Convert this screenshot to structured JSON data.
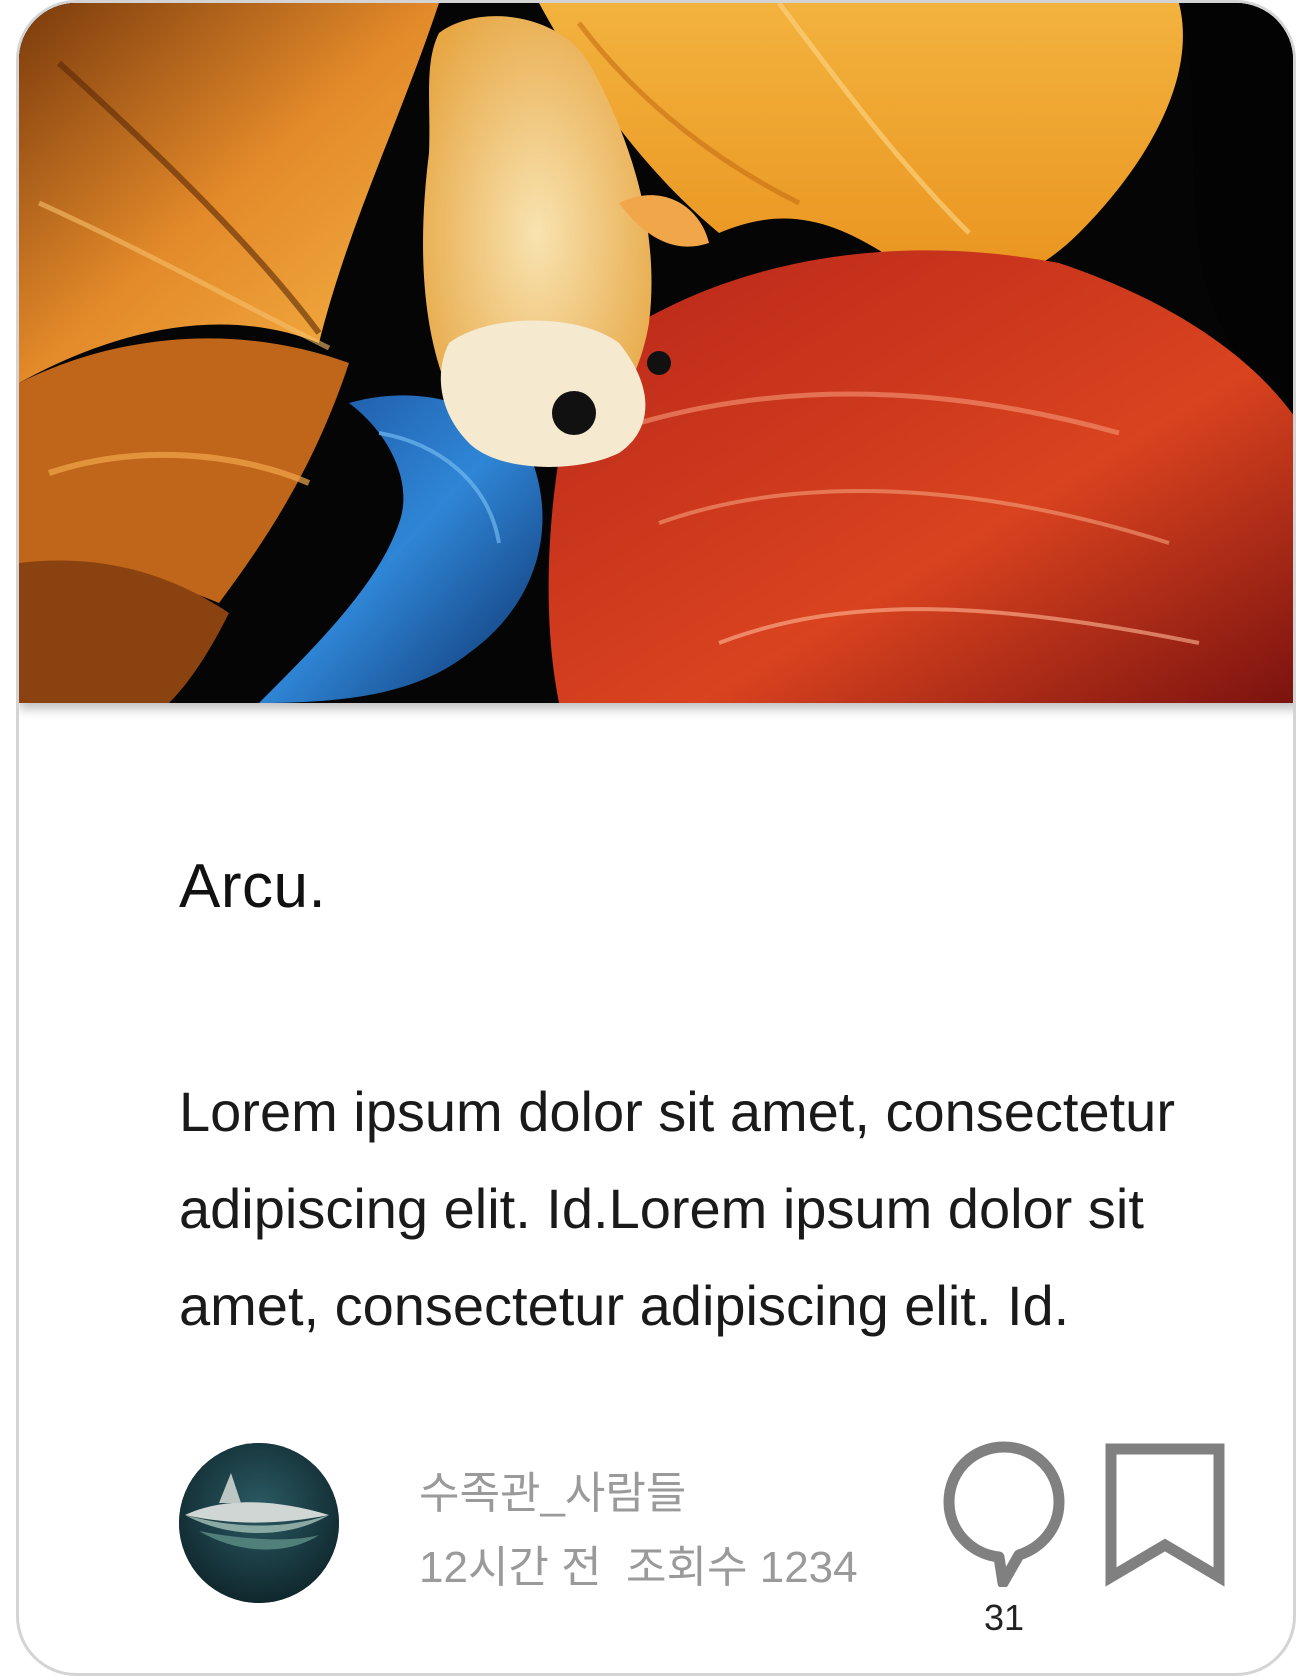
{
  "post": {
    "title": "Arcu.",
    "body": "Lorem ipsum dolor sit amet, consectetur adipiscing elit. Id.Lorem ipsum dolor sit amet, consectetur adipiscing elit. Id."
  },
  "author": {
    "name": "수족관_사람들",
    "meta": "12시간 전  조회수 1234"
  },
  "actions": {
    "comment_count": "31"
  },
  "icons": {
    "comment": "speech-bubble-icon",
    "bookmark": "bookmark-icon"
  },
  "colors": {
    "icon_gray": "#808080",
    "meta_gray": "#9a9a9a",
    "card_border": "#d4d4d4"
  }
}
